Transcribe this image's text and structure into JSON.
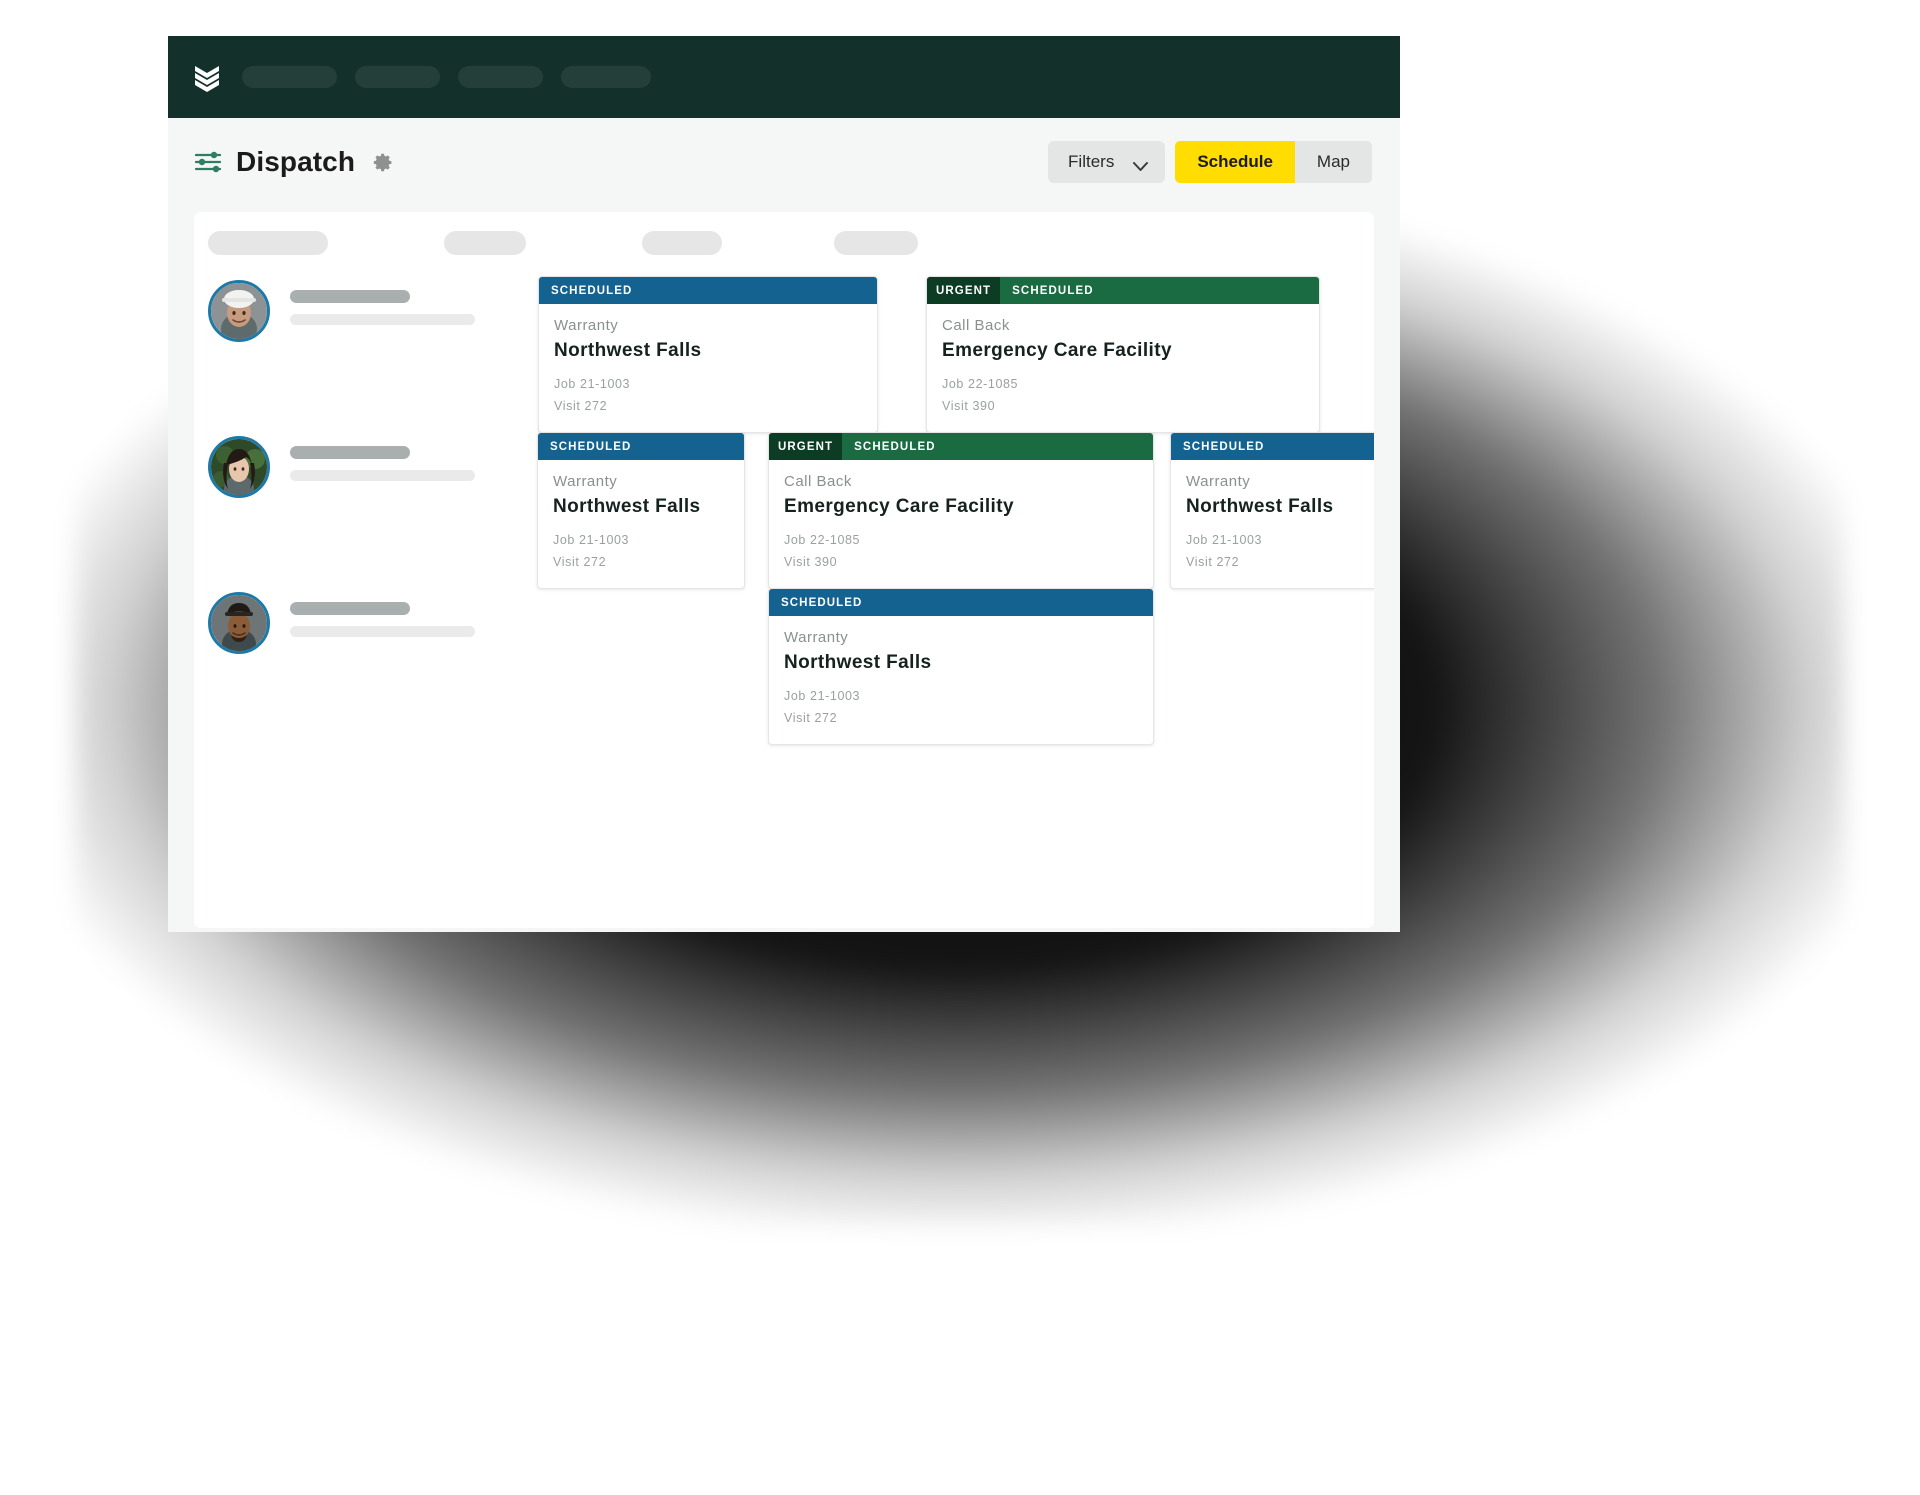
{
  "window": {
    "brand_logo_icon": "chevron-stack-logo",
    "nav_placeholder_count": 4,
    "nav_placeholder_widths": [
      95,
      85,
      85,
      90
    ]
  },
  "toolbar": {
    "sliders_icon": "sliders-icon",
    "title": "Dispatch",
    "gear_icon": "gear-icon",
    "filters_label": "Filters",
    "chevron_icon": "chevron-down-icon",
    "schedule_label": "Schedule",
    "map_label": "Map",
    "active_view": "Schedule",
    "accent_yellow": "#ffdd00",
    "brand_dark_green": "#14302a"
  },
  "board": {
    "header_pill_widths": [
      120,
      82,
      80,
      84
    ],
    "technicians": [
      {
        "avatar_icon": "avatar-technician-hardhat",
        "name_bar_width": 120,
        "sub_bar_width": 185
      },
      {
        "avatar_icon": "avatar-technician-woman",
        "name_bar_width": 120,
        "sub_bar_width": 185
      },
      {
        "avatar_icon": "avatar-technician-cap",
        "name_bar_width": 120,
        "sub_bar_width": 185
      }
    ],
    "jobs": [
      {
        "row": 0,
        "urgent": false,
        "urgent_label": "",
        "status_label": "SCHEDULED",
        "status_color": "#13628f",
        "job_type": "Warranty",
        "customer": "Northwest Falls",
        "job_number": "Job 21-1003",
        "visit_number": "Visit 272"
      },
      {
        "row": 0,
        "urgent": true,
        "urgent_label": "URGENT",
        "status_label": "SCHEDULED",
        "status_color": "#1a6b42",
        "job_type": "Call Back",
        "customer": "Emergency Care Facility",
        "job_number": "Job 22-1085",
        "visit_number": "Visit 390"
      },
      {
        "row": 1,
        "urgent": false,
        "urgent_label": "",
        "status_label": "SCHEDULED",
        "status_color": "#13628f",
        "job_type": "Warranty",
        "customer": "Northwest Falls",
        "job_number": "Job 21-1003",
        "visit_number": "Visit 272"
      },
      {
        "row": 1,
        "urgent": true,
        "urgent_label": "URGENT",
        "status_label": "SCHEDULED",
        "status_color": "#1a6b42",
        "job_type": "Call Back",
        "customer": "Emergency Care Facility",
        "job_number": "Job 22-1085",
        "visit_number": "Visit 390"
      },
      {
        "row": 1,
        "urgent": false,
        "urgent_label": "",
        "status_label": "SCHEDULED",
        "status_color": "#13628f",
        "job_type": "Warranty",
        "customer": "Northwest Falls",
        "job_number": "Job 21-1003",
        "visit_number": "Visit 272",
        "clipped": true
      },
      {
        "row": 2,
        "urgent": false,
        "urgent_label": "",
        "status_label": "SCHEDULED",
        "status_color": "#13628f",
        "job_type": "Warranty",
        "customer": "Northwest Falls",
        "job_number": "Job 21-1003",
        "visit_number": "Visit 272"
      }
    ]
  }
}
